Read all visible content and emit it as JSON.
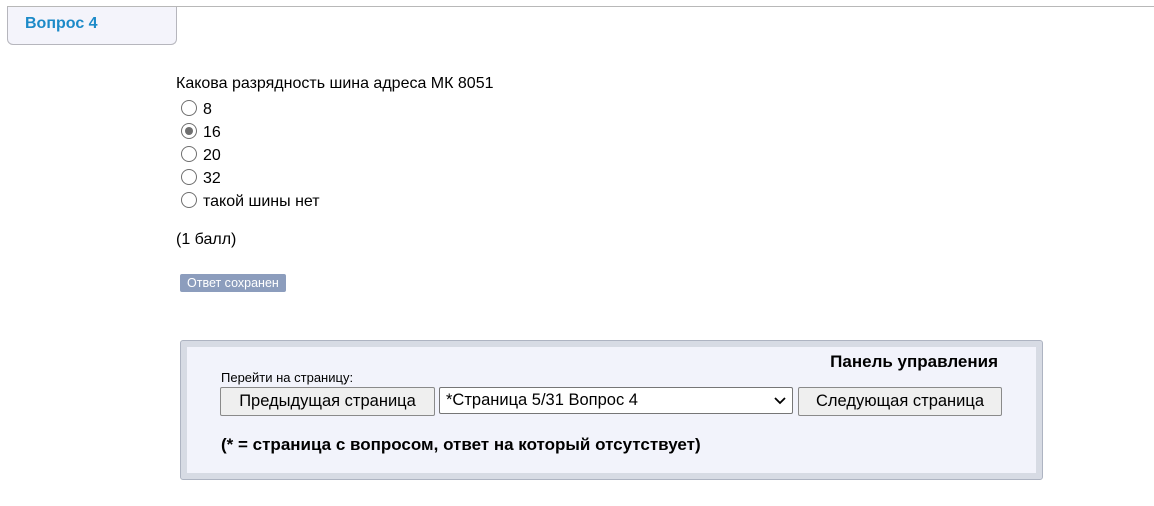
{
  "question_tab": {
    "label": "Вопрос 4"
  },
  "question": {
    "text": "Какова разрядность шина адреса МК 8051",
    "options": [
      {
        "label": "8",
        "selected": false
      },
      {
        "label": "16",
        "selected": true
      },
      {
        "label": "20",
        "selected": false
      },
      {
        "label": "32",
        "selected": false
      },
      {
        "label": "такой шины нет",
        "selected": false
      }
    ],
    "points": "(1 балл)",
    "saved_status": "Ответ сохранен"
  },
  "control_panel": {
    "title": "Панель управления",
    "goto_label": "Перейти на страницу:",
    "prev_label": "Предыдущая страница",
    "select_value": "*Страница 5/31 Вопрос 4",
    "next_label": "Следующая страница",
    "legend_note": "(* = страница с вопросом, ответ на который отсутствует)"
  },
  "colors": {
    "tab_label": "#1c8ac8",
    "saved_badge_bg": "#8c9dbd",
    "panel_frame": "#d7dbe4",
    "panel_bg": "#f2f3fb"
  },
  "icons": {
    "select_arrow": "chevron-down-icon"
  }
}
